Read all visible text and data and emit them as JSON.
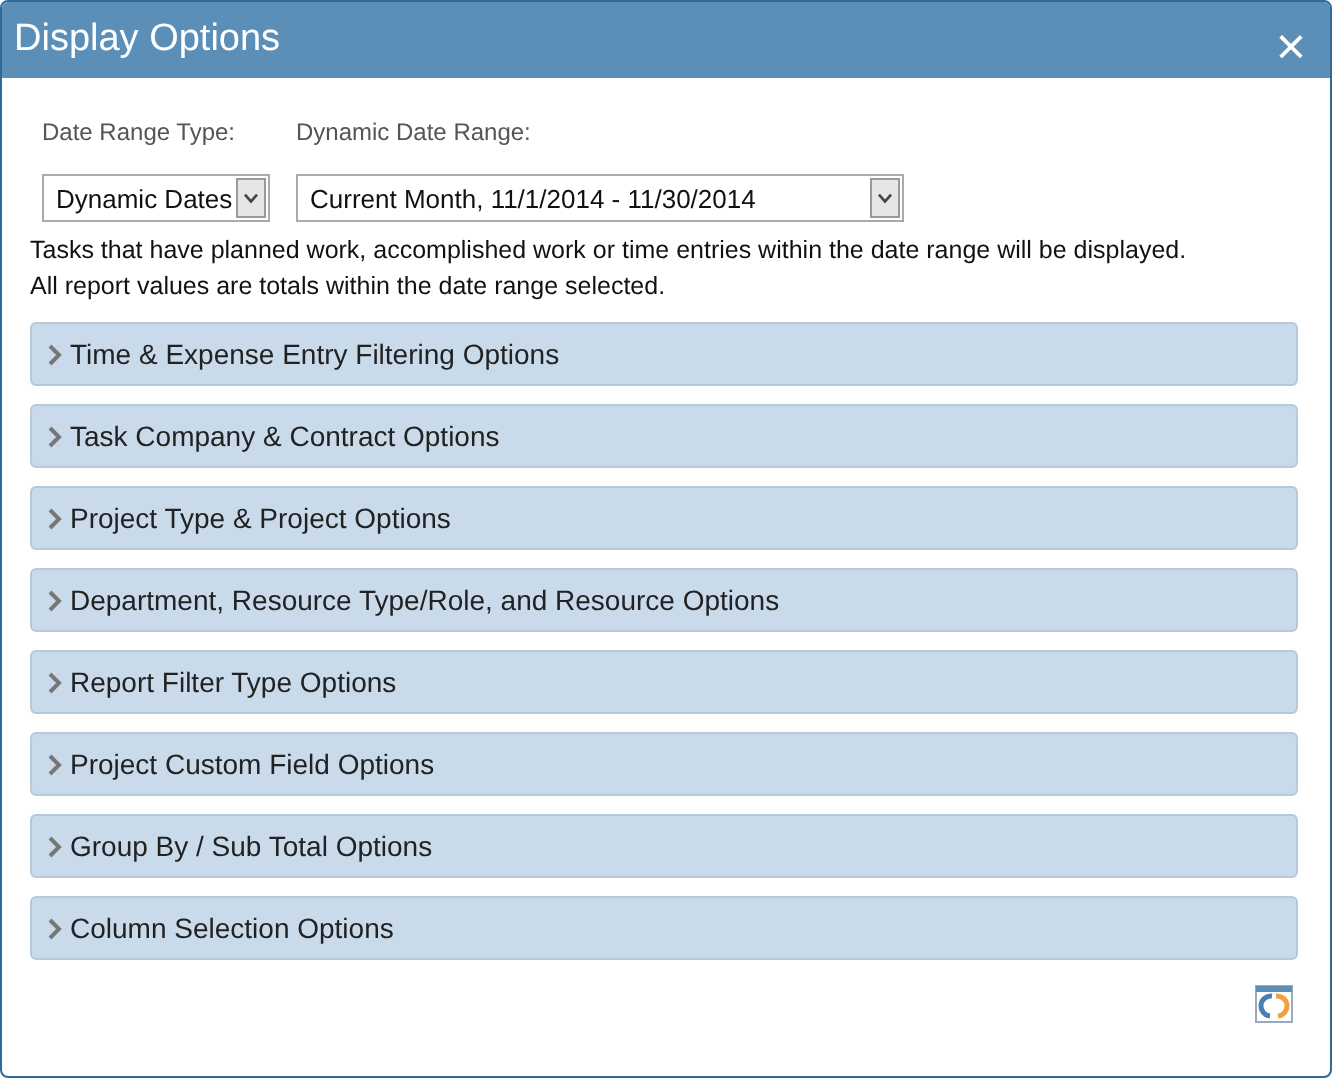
{
  "window": {
    "title": "Display Options",
    "close": "×"
  },
  "filters": [
    {
      "label": "Date Range Type:",
      "value": "Dynamic Dates",
      "wide": false
    },
    {
      "label": "Dynamic Date Range:",
      "value": "Current Month, 11/1/2014 - 11/30/2014",
      "wide": true
    }
  ],
  "notes": [
    "Tasks that have planned work, accomplished work or time entries within the date range will be displayed.",
    "All report values are totals within the date range selected."
  ],
  "sections": [
    {
      "label": "Time & Expense Entry Filtering Options",
      "expanded": false
    },
    {
      "label": "Task Company & Contract Options",
      "expanded": false
    },
    {
      "label": "Project Type & Project Options",
      "expanded": false
    },
    {
      "label": "Department, Resource Type/Role, and Resource Options",
      "expanded": false
    },
    {
      "label": "Report Filter Type Options",
      "expanded": false
    },
    {
      "label": "Project Custom Field Options",
      "expanded": false
    },
    {
      "label": "Group By / Sub Total Options",
      "expanded": false
    },
    {
      "label": "Column Selection Options",
      "expanded": false
    }
  ]
}
